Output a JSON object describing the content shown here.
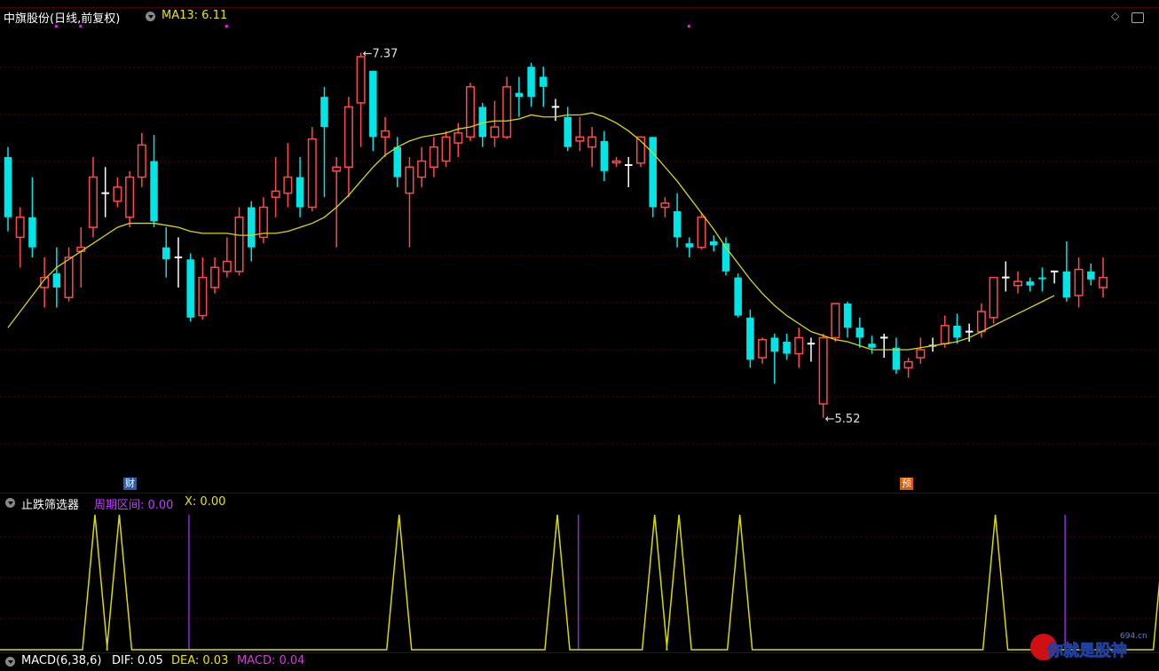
{
  "header": {
    "stock_name": "中旗股份(日线,前复权)",
    "ma_label": "MA13: 6.11",
    "high_label": "7.37",
    "low_label": "5.52"
  },
  "badges": {
    "cai": "财",
    "yu": "预"
  },
  "indicator": {
    "name": "止跌筛选器",
    "param1": "周期区间: 0.00",
    "param2": "X: 0.00"
  },
  "macd": {
    "name": "MACD(6,38,6)",
    "dif": "DIF: 0.05",
    "dea": "DEA: 0.03",
    "macd": "MACD: 0.04"
  },
  "watermark": {
    "text": "你就是股神",
    "site": "694.cn"
  },
  "colors": {
    "up": "#ff4a4a",
    "down": "#00e5e5",
    "doji": "#ffffff",
    "ma": "#d9d900",
    "signal": "#d9d900",
    "marker": "#8a2be2"
  },
  "price_range": [
    5.2,
    7.5
  ],
  "candles": [
    [
      6.55,
      6.85,
      6.48,
      6.9,
      "d"
    ],
    [
      6.45,
      6.55,
      6.3,
      6.6,
      "u"
    ],
    [
      6.55,
      6.4,
      6.35,
      6.75,
      "d"
    ],
    [
      6.2,
      6.25,
      6.1,
      6.35,
      "u"
    ],
    [
      6.27,
      6.2,
      6.1,
      6.4,
      "d"
    ],
    [
      6.15,
      6.35,
      6.13,
      6.4,
      "u"
    ],
    [
      6.38,
      6.4,
      6.2,
      6.5,
      "u"
    ],
    [
      6.5,
      6.75,
      6.45,
      6.85,
      "u"
    ],
    [
      6.65,
      6.67,
      6.55,
      6.8,
      "x"
    ],
    [
      6.63,
      6.7,
      6.6,
      6.75,
      "u"
    ],
    [
      6.55,
      6.75,
      6.5,
      6.78,
      "u"
    ],
    [
      6.75,
      6.91,
      6.7,
      6.97,
      "u"
    ],
    [
      6.83,
      6.53,
      6.5,
      6.96,
      "d"
    ],
    [
      6.4,
      6.34,
      6.25,
      6.5,
      "d"
    ],
    [
      6.35,
      6.33,
      6.2,
      6.45,
      "x"
    ],
    [
      6.34,
      6.05,
      6.03,
      6.37,
      "d"
    ],
    [
      6.06,
      6.25,
      6.04,
      6.35,
      "u"
    ],
    [
      6.2,
      6.3,
      6.17,
      6.35,
      "u"
    ],
    [
      6.28,
      6.33,
      6.25,
      6.45,
      "u"
    ],
    [
      6.28,
      6.55,
      6.26,
      6.6,
      "u"
    ],
    [
      6.6,
      6.4,
      6.33,
      6.63,
      "d"
    ],
    [
      6.45,
      6.6,
      6.42,
      6.65,
      "u"
    ],
    [
      6.65,
      6.68,
      6.55,
      6.85,
      "u"
    ],
    [
      6.67,
      6.75,
      6.6,
      6.92,
      "u"
    ],
    [
      6.75,
      6.6,
      6.55,
      6.85,
      "d"
    ],
    [
      6.6,
      6.94,
      6.58,
      7.0,
      "u"
    ],
    [
      7.0,
      7.15,
      6.65,
      7.2,
      "d"
    ],
    [
      6.78,
      6.8,
      6.4,
      6.85,
      "u"
    ],
    [
      6.8,
      7.1,
      6.65,
      7.15,
      "u"
    ],
    [
      7.12,
      7.35,
      6.9,
      7.37,
      "u"
    ],
    [
      7.28,
      6.95,
      6.88,
      7.28,
      "d"
    ],
    [
      6.95,
      6.98,
      6.85,
      7.05,
      "u"
    ],
    [
      6.9,
      6.75,
      6.7,
      6.95,
      "d"
    ],
    [
      6.67,
      6.8,
      6.4,
      6.85,
      "u"
    ],
    [
      6.75,
      6.83,
      6.7,
      6.9,
      "u"
    ],
    [
      6.8,
      6.9,
      6.75,
      6.95,
      "u"
    ],
    [
      6.83,
      6.95,
      6.8,
      6.98,
      "u"
    ],
    [
      6.92,
      6.97,
      6.85,
      7.02,
      "u"
    ],
    [
      6.95,
      7.2,
      6.93,
      7.22,
      "u"
    ],
    [
      7.1,
      6.95,
      6.9,
      7.12,
      "d"
    ],
    [
      6.95,
      7.0,
      6.9,
      7.13,
      "u"
    ],
    [
      6.95,
      7.2,
      6.94,
      7.25,
      "u"
    ],
    [
      7.17,
      7.15,
      7.05,
      7.25,
      "d"
    ],
    [
      7.15,
      7.3,
      7.1,
      7.32,
      "d"
    ],
    [
      7.2,
      7.25,
      7.1,
      7.3,
      "d"
    ],
    [
      7.1,
      7.1,
      7.03,
      7.14,
      "x"
    ],
    [
      7.05,
      6.9,
      6.88,
      7.1,
      "d"
    ],
    [
      6.95,
      6.93,
      6.88,
      7.05,
      "u"
    ],
    [
      6.9,
      6.95,
      6.8,
      7.0,
      "u"
    ],
    [
      6.93,
      6.78,
      6.73,
      6.98,
      "d"
    ],
    [
      6.83,
      6.83,
      6.8,
      6.85,
      "u"
    ],
    [
      6.81,
      6.8,
      6.7,
      6.85,
      "x"
    ],
    [
      6.82,
      6.95,
      6.8,
      6.92,
      "u"
    ],
    [
      6.95,
      6.6,
      6.55,
      6.95,
      "d"
    ],
    [
      6.6,
      6.62,
      6.55,
      6.65,
      "u"
    ],
    [
      6.58,
      6.45,
      6.4,
      6.67,
      "d"
    ],
    [
      6.42,
      6.4,
      6.35,
      6.45,
      "d"
    ],
    [
      6.4,
      6.55,
      6.39,
      6.57,
      "u"
    ],
    [
      6.43,
      6.41,
      6.38,
      6.46,
      "d"
    ],
    [
      6.42,
      6.28,
      6.26,
      6.45,
      "d"
    ],
    [
      6.25,
      6.06,
      6.05,
      6.27,
      "d"
    ],
    [
      6.05,
      5.84,
      5.8,
      6.09,
      "d"
    ],
    [
      5.85,
      5.94,
      5.82,
      5.95,
      "u"
    ],
    [
      5.95,
      5.88,
      5.72,
      5.97,
      "d"
    ],
    [
      5.93,
      5.87,
      5.84,
      5.97,
      "d"
    ],
    [
      5.87,
      5.95,
      5.8,
      6.0,
      "u"
    ],
    [
      5.88,
      5.92,
      5.83,
      5.95,
      "x"
    ],
    [
      5.62,
      5.95,
      5.55,
      5.97,
      "u"
    ],
    [
      5.95,
      6.12,
      5.93,
      6.12,
      "u"
    ],
    [
      6.12,
      6.0,
      5.95,
      6.13,
      "d"
    ],
    [
      6.0,
      5.95,
      5.9,
      6.05,
      "d"
    ],
    [
      5.92,
      5.9,
      5.87,
      5.96,
      "d"
    ],
    [
      5.9,
      5.95,
      5.85,
      5.97,
      "x"
    ],
    [
      5.9,
      5.79,
      5.77,
      5.95,
      "d"
    ],
    [
      5.8,
      5.83,
      5.75,
      5.85,
      "u"
    ],
    [
      5.85,
      5.89,
      5.82,
      5.95,
      "u"
    ],
    [
      5.91,
      5.91,
      5.88,
      5.95,
      "x"
    ],
    [
      5.92,
      6.01,
      5.9,
      6.06,
      "u"
    ],
    [
      6.01,
      5.95,
      5.92,
      6.07,
      "d"
    ],
    [
      5.96,
      5.98,
      5.93,
      6.02,
      "x"
    ],
    [
      5.98,
      6.08,
      5.95,
      6.12,
      "u"
    ],
    [
      6.05,
      6.25,
      6.02,
      6.25,
      "u"
    ],
    [
      6.25,
      6.2,
      6.18,
      6.33,
      "x"
    ],
    [
      6.21,
      6.23,
      6.17,
      6.28,
      "u"
    ],
    [
      6.23,
      6.21,
      6.18,
      6.25,
      "d"
    ],
    [
      6.25,
      6.25,
      6.18,
      6.3,
      "d"
    ],
    [
      6.28,
      6.25,
      6.22,
      6.28,
      "x"
    ],
    [
      6.15,
      6.28,
      6.13,
      6.43,
      "d"
    ],
    [
      6.16,
      6.29,
      6.1,
      6.35,
      "u"
    ],
    [
      6.24,
      6.28,
      6.21,
      6.32,
      "d"
    ],
    [
      6.2,
      6.25,
      6.15,
      6.35,
      "u"
    ]
  ],
  "ma13": [
    6.0,
    6.08,
    6.16,
    6.24,
    6.3,
    6.34,
    6.38,
    6.42,
    6.46,
    6.5,
    6.52,
    6.52,
    6.52,
    6.51,
    6.5,
    6.48,
    6.47,
    6.47,
    6.47,
    6.46,
    6.46,
    6.47,
    6.47,
    6.48,
    6.5,
    6.52,
    6.55,
    6.6,
    6.66,
    6.73,
    6.8,
    6.86,
    6.9,
    6.93,
    6.95,
    6.96,
    6.97,
    6.99,
    7.0,
    7.02,
    7.03,
    7.03,
    7.04,
    7.06,
    7.05,
    7.05,
    7.06,
    7.06,
    7.07,
    7.05,
    7.02,
    6.98,
    6.93,
    6.87,
    6.8,
    6.73,
    6.65,
    6.57,
    6.49,
    6.4,
    6.32,
    6.24,
    6.17,
    6.11,
    6.06,
    6.02,
    5.98,
    5.96,
    5.94,
    5.93,
    5.91,
    5.89,
    5.89,
    5.89,
    5.89,
    5.9,
    5.91,
    5.92,
    5.93,
    5.95,
    5.98,
    6.01,
    6.04,
    6.07,
    6.1,
    6.13,
    6.16
  ],
  "signal_peaks": [
    7,
    9,
    32,
    45,
    53,
    55,
    60,
    81,
    95
  ],
  "marker_lines": [
    14,
    46,
    86
  ],
  "top_marks": [
    4,
    6,
    18,
    56
  ]
}
